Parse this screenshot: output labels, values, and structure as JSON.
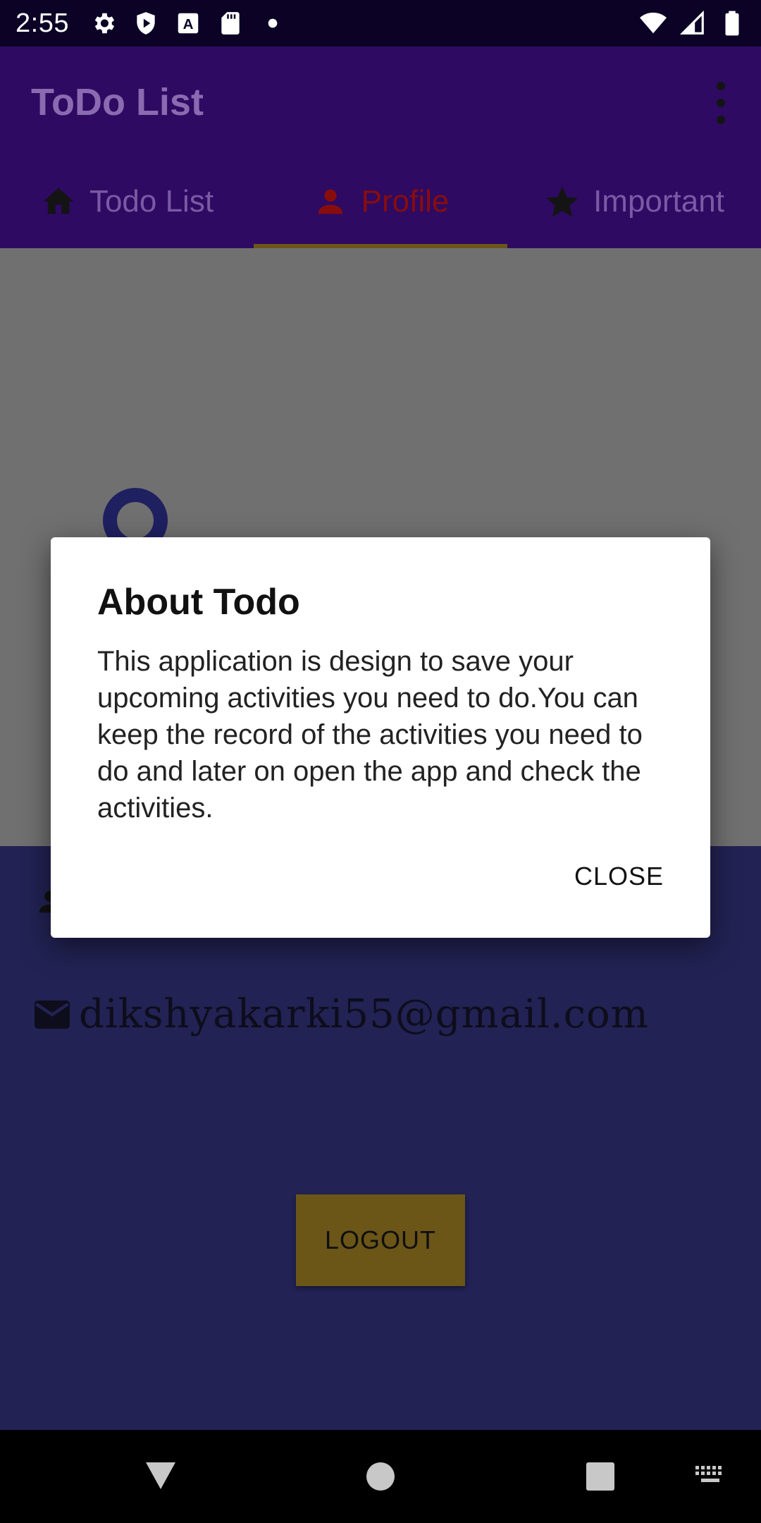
{
  "status_bar": {
    "time": "2:55",
    "left_icons": [
      "gear-icon",
      "shield-icon",
      "font-a-icon",
      "sd-card-icon",
      "dot-icon"
    ],
    "right_icons": [
      "wifi-icon",
      "signal-icon",
      "battery-icon"
    ]
  },
  "app_bar": {
    "title": "ToDo List",
    "menu_icon": "more-vert-icon"
  },
  "tabs": [
    {
      "label": "Todo List",
      "icon": "home-icon",
      "active": false
    },
    {
      "label": "Profile",
      "icon": "person-icon",
      "active": true
    },
    {
      "label": "Important",
      "icon": "star-icon",
      "active": false
    }
  ],
  "profile": {
    "email": "dikshyakarki55@gmail.com",
    "email_icon": "mail-icon",
    "logout_label": "LOGOUT"
  },
  "dialog": {
    "title": "About Todo",
    "body": "This application is design to save your upcoming activities you need to do.You can keep the record of the activities you need to do and later on open the app and check the activities.",
    "close_label": "CLOSE"
  },
  "nav_bar": {
    "buttons": [
      "back-icon",
      "home-circle-icon",
      "recents-icon",
      "keyboard-icon"
    ]
  },
  "colors": {
    "app_bar": "#2e0a63",
    "active_tab_text": "#880d0d",
    "tab_indicator": "#6b5618",
    "profile_background": "#222254",
    "logout_button": "#6b5618"
  }
}
